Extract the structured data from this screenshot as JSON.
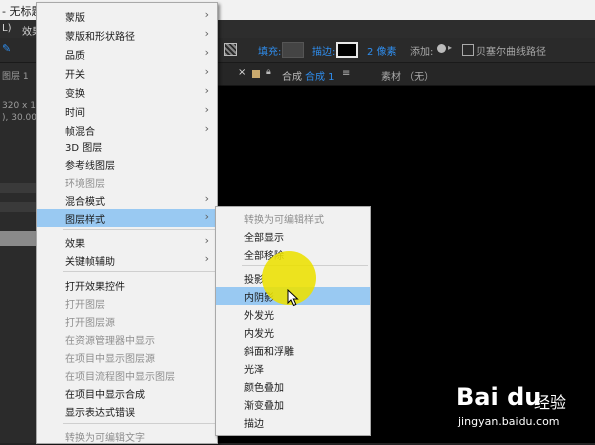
{
  "window": {
    "title": "- 无标题"
  },
  "menubar": {
    "items": [
      "L)",
      "效果"
    ]
  },
  "toolbar": {
    "fill_label": "填充:",
    "stroke_label": "描边:",
    "stroke_width": "2 像素",
    "add_label": "添加:",
    "bezier_label": "贝塞尔曲线路径"
  },
  "left_panel": {
    "layer_tab": "图层 1",
    "info_line1": "320 x 180",
    "info_line2": "), 30.00 f"
  },
  "comp_tab": {
    "comp_label": "合成",
    "comp_name": "合成 1",
    "menu_glyph": "≡",
    "footage_label": "素材 （无）"
  },
  "main_menu": {
    "items": [
      {
        "label": "蒙版",
        "submenu": true,
        "disabled": false
      },
      {
        "label": "蒙版和形状路径",
        "submenu": true,
        "disabled": false
      },
      {
        "label": "品质",
        "submenu": true,
        "disabled": false
      },
      {
        "label": "开关",
        "submenu": true,
        "disabled": false
      },
      {
        "label": "变换",
        "submenu": true,
        "disabled": false
      },
      {
        "label": "时间",
        "submenu": true,
        "disabled": false
      },
      {
        "label": "帧混合",
        "submenu": true,
        "disabled": false
      },
      {
        "label": "3D 图层",
        "submenu": false,
        "disabled": false
      },
      {
        "label": "参考线图层",
        "submenu": false,
        "disabled": false
      },
      {
        "label": "环境图层",
        "submenu": false,
        "disabled": true
      },
      {
        "label": "混合模式",
        "submenu": true,
        "disabled": false
      },
      {
        "label": "图层样式",
        "submenu": true,
        "disabled": false,
        "highlighted": true
      },
      {
        "label": "效果",
        "submenu": true,
        "disabled": false
      },
      {
        "label": "关键帧辅助",
        "submenu": true,
        "disabled": false
      },
      {
        "label": "打开效果控件",
        "submenu": false,
        "disabled": false
      },
      {
        "label": "打开图层",
        "submenu": false,
        "disabled": true
      },
      {
        "label": "打开图层源",
        "submenu": false,
        "disabled": true
      },
      {
        "label": "在资源管理器中显示",
        "submenu": false,
        "disabled": true
      },
      {
        "label": "在项目中显示图层源",
        "submenu": false,
        "disabled": true
      },
      {
        "label": "在项目流程图中显示图层",
        "submenu": false,
        "disabled": true
      },
      {
        "label": "在项目中显示合成",
        "submenu": false,
        "disabled": false
      },
      {
        "label": "显示表达式错误",
        "submenu": false,
        "disabled": false
      },
      {
        "label": "转换为可编辑文字",
        "submenu": false,
        "disabled": true
      }
    ]
  },
  "sub_menu": {
    "items": [
      {
        "label": "转换为可编辑样式",
        "disabled": true
      },
      {
        "label": "全部显示",
        "disabled": false
      },
      {
        "label": "全部移除",
        "disabled": false
      },
      {
        "label": "投影",
        "disabled": false
      },
      {
        "label": "内阴影",
        "disabled": false,
        "highlighted": true
      },
      {
        "label": "外发光",
        "disabled": false
      },
      {
        "label": "内发光",
        "disabled": false
      },
      {
        "label": "斜面和浮雕",
        "disabled": false
      },
      {
        "label": "光泽",
        "disabled": false
      },
      {
        "label": "颜色叠加",
        "disabled": false
      },
      {
        "label": "渐变叠加",
        "disabled": false
      },
      {
        "label": "描边",
        "disabled": false
      }
    ]
  },
  "watermark": {
    "logo": "Bai du",
    "brand": "经验",
    "url": "jingyan.baidu.com"
  },
  "colors": {
    "highlight": "#99c9f2",
    "menu_bg": "#f1f1f1",
    "accent_blue": "#2f8ded",
    "cursor_highlight": "#ece000"
  }
}
